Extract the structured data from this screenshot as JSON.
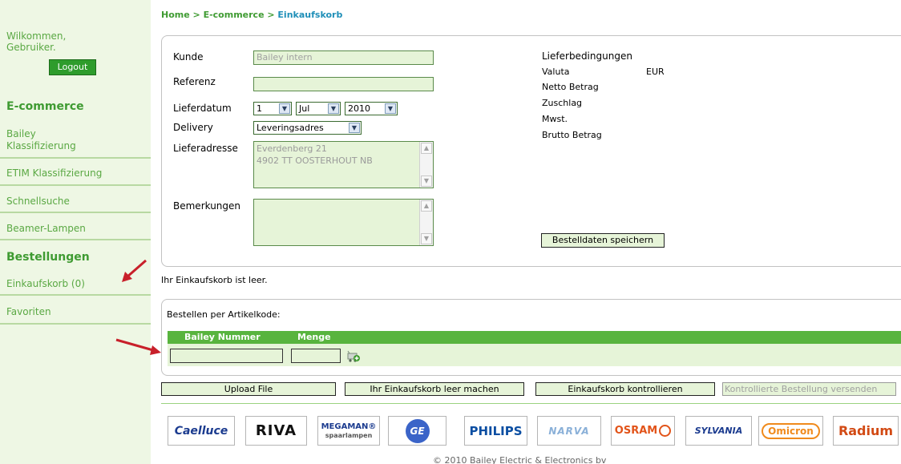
{
  "breadcrumb": {
    "home": "Home",
    "sep1": " > ",
    "ecommerce": "E-commerce",
    "sep2": " > ",
    "current": "Einkaufskorb"
  },
  "sidebar": {
    "welcome_line1": "Wilkommen,",
    "welcome_line2": "Gebruiker.",
    "logout": "Logout",
    "section_ecommerce": "E-commerce",
    "items": [
      {
        "label_line1": "Bailey",
        "label_line2": "Klassifizierung"
      },
      {
        "label": "ETIM Klassifizierung"
      },
      {
        "label": "Schnellsuche"
      },
      {
        "label": "Beamer-Lampen"
      }
    ],
    "section_orders": "Bestellungen",
    "cart": "Einkaufskorb (0)",
    "favorites": "Favoriten"
  },
  "order": {
    "kunde_label": "Kunde",
    "kunde_value": "Bailey intern",
    "referenz_label": "Referenz",
    "referenz_value": "",
    "lieferdatum_label": "Lieferdatum",
    "day": "1",
    "month": "Jul",
    "year": "2010",
    "delivery_label": "Delivery",
    "delivery_value": "Leveringsadres",
    "lieferadresse_label": "Lieferadresse",
    "address_line1": "Everdenberg 21",
    "address_line2": "4902 TT  OOSTERHOUT NB",
    "bemerkungen_label": "Bemerkungen",
    "lieferbedingungen": "Lieferbedingungen",
    "valuta_label": "Valuta",
    "valuta_value": "EUR",
    "netto": "Netto Betrag",
    "zuschlag": "Zuschlag",
    "mwst": "Mwst.",
    "brutto": "Brutto Betrag",
    "save_button": "Bestelldaten speichern"
  },
  "cart_empty": "Ihr Einkaufskorb ist leer.",
  "code_order": {
    "title": "Bestellen per Artikelkode:",
    "col_number": "Bailey Nummer",
    "col_qty": "Menge"
  },
  "actions": {
    "upload": "Upload File",
    "empty_cart": "Ihr Einkaufskorb leer machen",
    "check_cart": "Einkaufskorb kontrollieren",
    "send_checked": "Kontrollierte Bestellung versenden"
  },
  "logos": {
    "cael": "Caelluce",
    "riva": "RIVA",
    "megaman_1": "MEGAMAN®",
    "megaman_2": "spaarlampen",
    "ge": "GE",
    "philips": "PHILIPS",
    "narva": "NARVA",
    "osram": "OSRAM",
    "sylvania": "SYLVANIA",
    "omicron": "Omicron",
    "radium": "Radium"
  },
  "footer": "© 2010 Bailey Electric & Electronics bv",
  "colors": {
    "accent_green": "#58b43e",
    "sidebar_bg": "#eef7e4",
    "field_bg": "#e6f4d8",
    "arrow_red": "#c8202a"
  }
}
